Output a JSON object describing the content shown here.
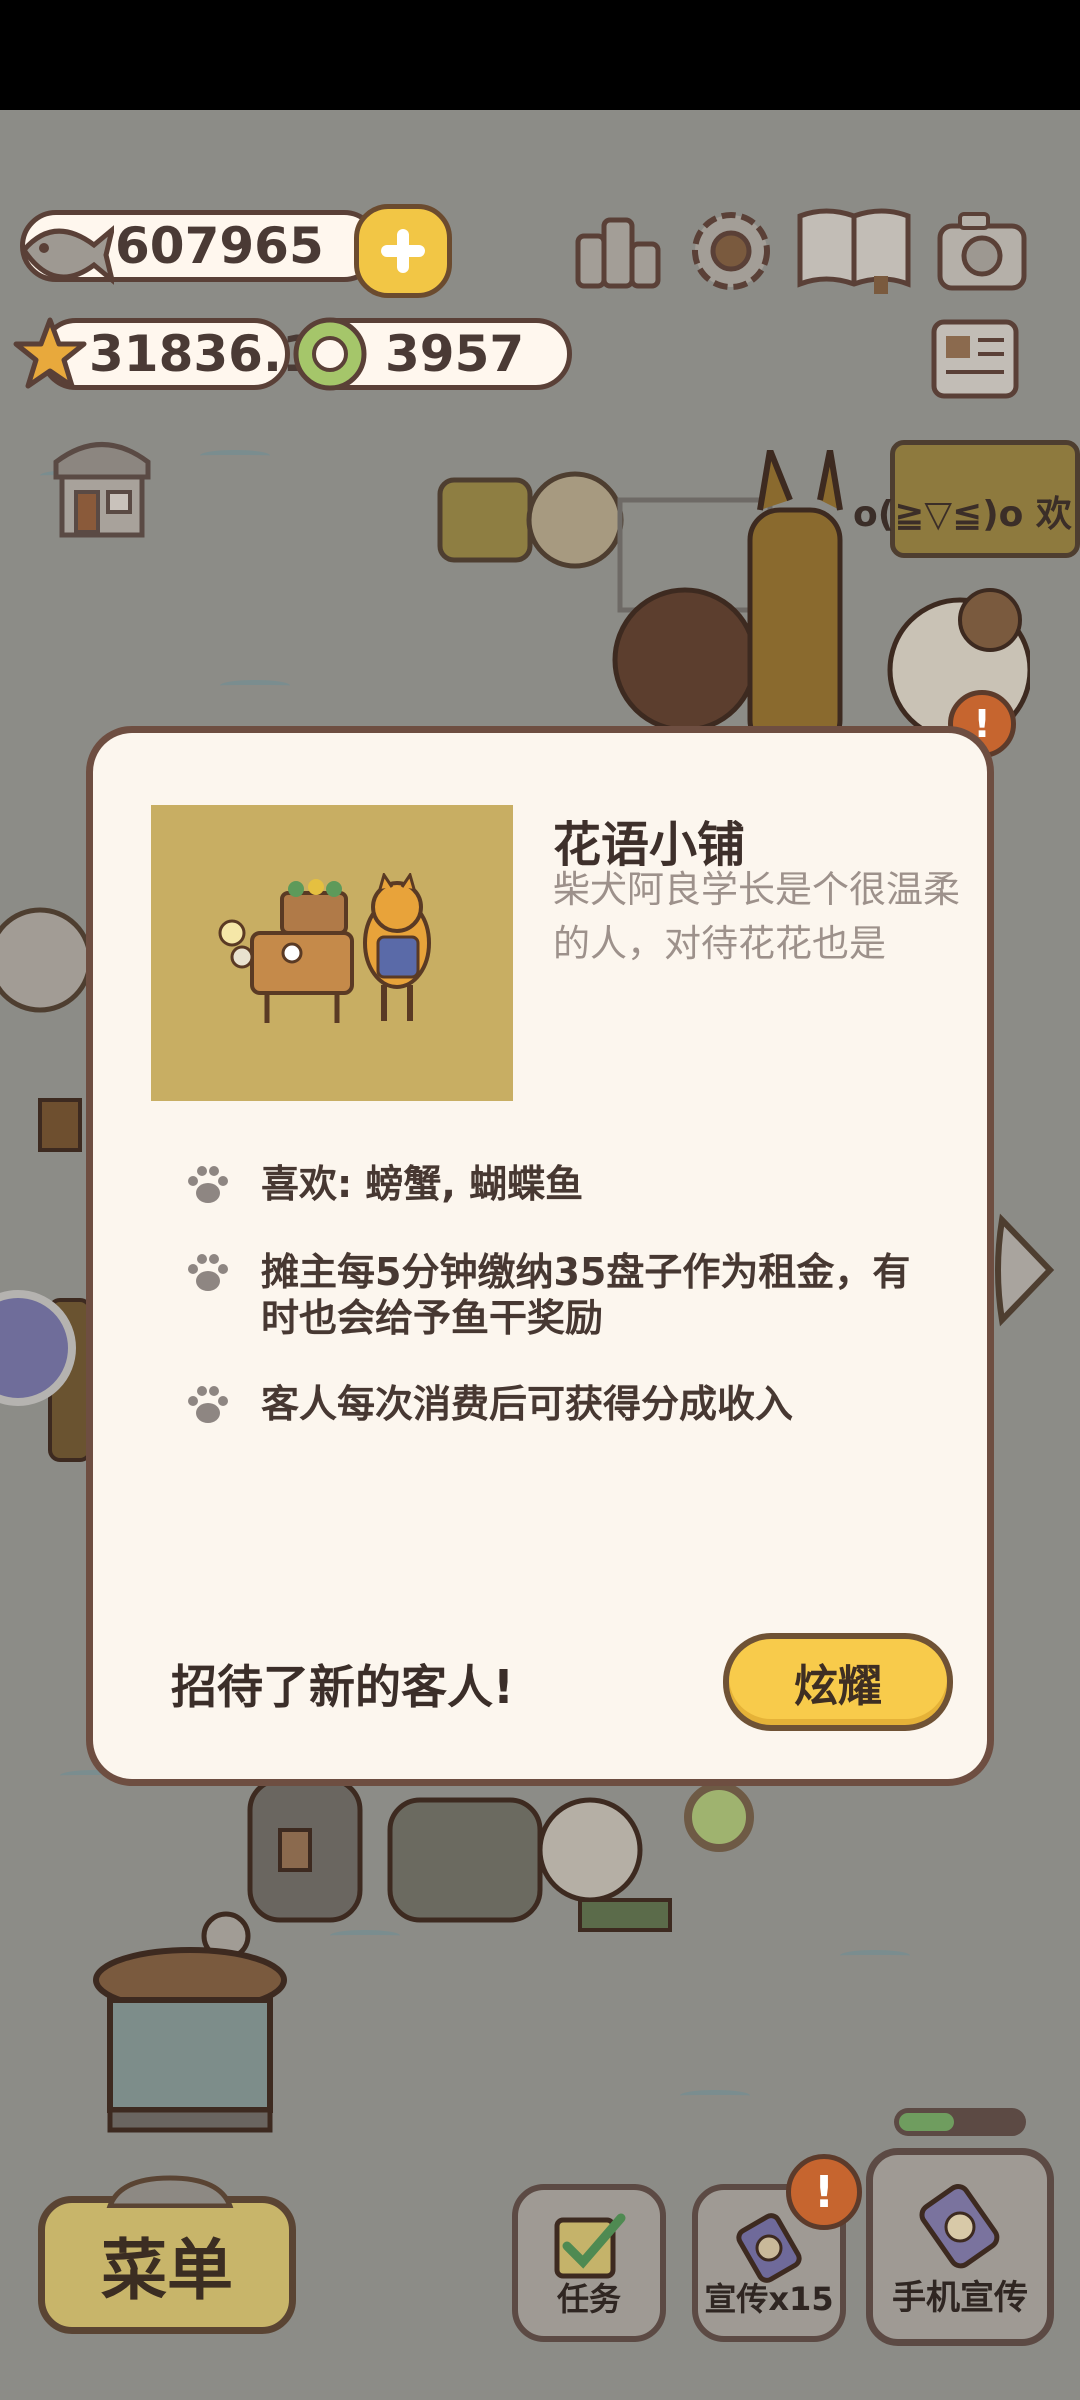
{
  "resources": {
    "fish": "607965",
    "stars": "31836.1",
    "coins": "3957"
  },
  "banner_text": "o(≧▽≦)o 欢",
  "modal": {
    "shop_name": "花语小铺",
    "description": "柴犬阿良学长是个很温柔的人，对待花花也是",
    "bullets": [
      "喜欢: 螃蟹, 蝴蝶鱼",
      "摊主每5分钟缴纳35盘子作为租金，有时也会给予鱼干奖励",
      "客人每次消费后可获得分成收入"
    ],
    "served_message": "招待了新的客人!",
    "show_off_label": "炫耀"
  },
  "bottom": {
    "menu_label": "菜单",
    "tasks_label": "任务",
    "promote_label": "宣传x15",
    "phone_promote_label": "手机宣传",
    "promotion_progress": 0.45
  },
  "icons": {
    "fish": "fish-icon",
    "star": "star-icon",
    "coin": "coin-icon",
    "plus": "plus-icon",
    "ranking": "ranking-icon",
    "settings": "gear-icon",
    "album": "album-book-icon",
    "camera": "camera-icon",
    "newspaper": "newspaper-icon",
    "shop": "shop-icon",
    "paw": "paw-icon"
  },
  "colors": {
    "accent_yellow": "#f8cb4b",
    "border_brown": "#6e4e41",
    "modal_bg": "#fcf6ee"
  }
}
